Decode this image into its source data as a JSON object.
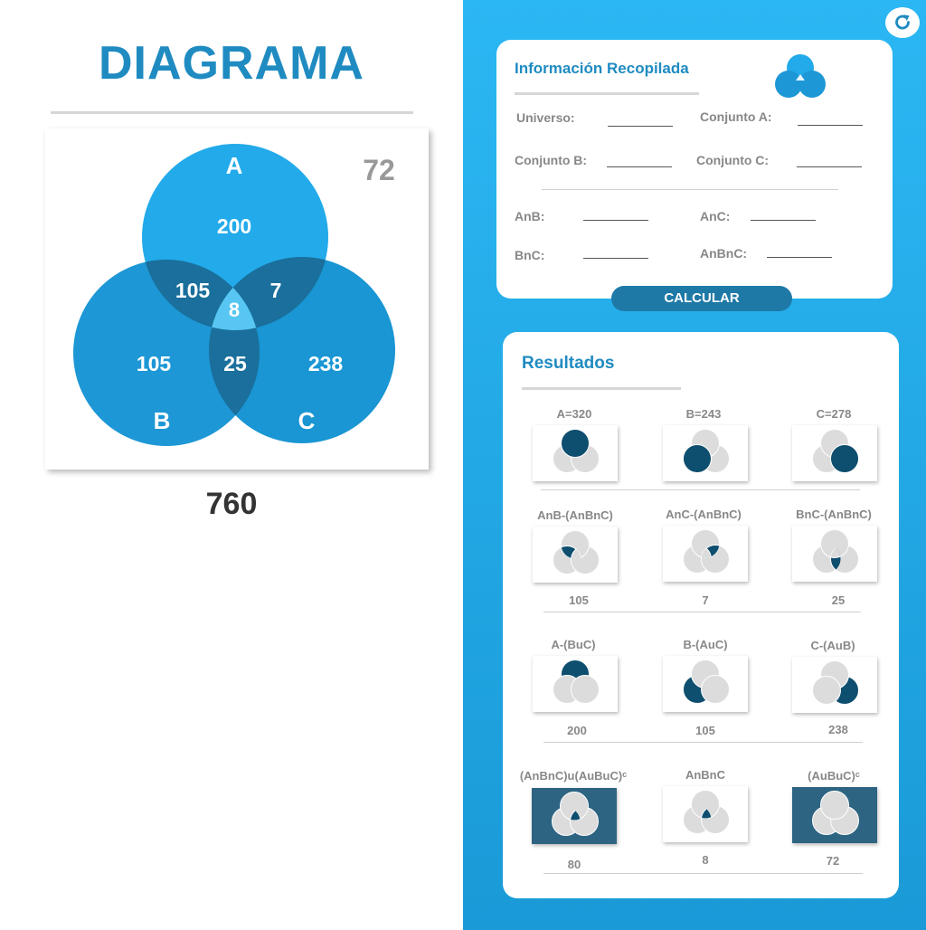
{
  "diagram": {
    "title": "DIAGRAMA",
    "outside_value": "72",
    "set_labels": {
      "a": "A",
      "b": "B",
      "c": "C"
    },
    "regions": {
      "a_only": "200",
      "b_only": "105",
      "c_only": "238",
      "ab_only": "105",
      "ac_only": "7",
      "bc_only": "25",
      "abc": "8"
    },
    "universe_total": "760"
  },
  "info": {
    "title": "Información Recopilada",
    "fields": [
      {
        "label": "Universo:",
        "value": ""
      },
      {
        "label": "Conjunto A:",
        "value": ""
      },
      {
        "label": "Conjunto B:",
        "value": ""
      },
      {
        "label": "Conjunto C:",
        "value": ""
      },
      {
        "label": "AnB:",
        "value": ""
      },
      {
        "label": "AnC:",
        "value": ""
      },
      {
        "label": "BnC:",
        "value": ""
      },
      {
        "label": "AnBnC:",
        "value": ""
      }
    ],
    "calculate_label": "CALCULAR"
  },
  "results": {
    "title": "Resultados",
    "cells": [
      {
        "label": "A=320",
        "value": "",
        "highlight": "A"
      },
      {
        "label": "B=243",
        "value": "",
        "highlight": "B"
      },
      {
        "label": "C=278",
        "value": "",
        "highlight": "C"
      },
      {
        "label": "AnB-(AnBnC)",
        "value": "105",
        "highlight": "ab_only"
      },
      {
        "label": "AnC-(AnBnC)",
        "value": "7",
        "highlight": "ac_only"
      },
      {
        "label": "BnC-(AnBnC)",
        "value": "25",
        "highlight": "bc_only"
      },
      {
        "label": "A-(BuC)",
        "value": "200",
        "highlight": "a_only"
      },
      {
        "label": "B-(AuC)",
        "value": "105",
        "highlight": "b_only"
      },
      {
        "label": "C-(AuB)",
        "value": "238",
        "highlight": "c_only"
      },
      {
        "label": "(AnBnC)u(AuBuC)ᶜ",
        "value": "80",
        "highlight": "abc_plus_outside"
      },
      {
        "label": "AnBnC",
        "value": "8",
        "highlight": "abc"
      },
      {
        "label": "(AuBuC)ᶜ",
        "value": "72",
        "highlight": "outside"
      }
    ]
  },
  "colors": {
    "accent": "#1f8bc1",
    "panel_background": "#2bb7f3",
    "venn_primary": "#1d9bd8",
    "venn_overlap": "#1a6f9c",
    "venn_center": "#58c6f2",
    "thumb_highlight": "#0e4e6e",
    "thumb_dark_background": "#2d6482"
  }
}
